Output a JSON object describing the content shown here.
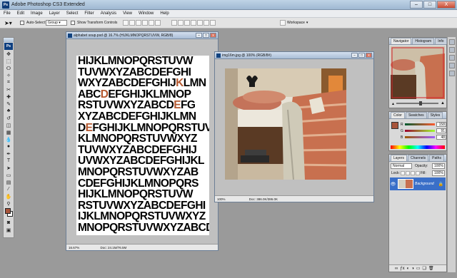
{
  "app": {
    "title": "Adobe Photoshop CS3 Extended",
    "logo": "Ps"
  },
  "window_controls": {
    "minimize": "–",
    "maximize": "□",
    "close": "X"
  },
  "menu": [
    "File",
    "Edit",
    "Image",
    "Layer",
    "Select",
    "Filter",
    "Analysis",
    "View",
    "Window",
    "Help"
  ],
  "options": {
    "auto_select_label": "Auto-Select:",
    "auto_select_value": "Group",
    "transform_label": "Show Transform Controls",
    "workspace_label": "Workspace"
  },
  "toolbox": {
    "logo": "Ps",
    "foreground_color": "#a8543a",
    "background_color": "#ffffff",
    "tools": [
      "move-tool",
      "marquee-tool",
      "lasso-tool",
      "magic-wand-tool",
      "crop-tool",
      "slice-tool",
      "healing-brush-tool",
      "brush-tool",
      "clone-stamp-tool",
      "history-brush-tool",
      "eraser-tool",
      "gradient-tool",
      "blur-tool",
      "dodge-tool",
      "pen-tool",
      "type-tool",
      "path-selection-tool",
      "shape-tool",
      "notes-tool",
      "eyedropper-tool",
      "hand-tool",
      "zoom-tool"
    ],
    "tool_glyphs": [
      "✥",
      "⬚",
      "ⵔ",
      "✧",
      "⌗",
      "✂",
      "✚",
      "✎",
      "♣",
      "↺",
      "◫",
      "▦",
      "💧",
      "●",
      "✒",
      "T",
      "➤",
      "▭",
      "▤",
      "⁄",
      "✋",
      "⚲"
    ]
  },
  "documents": {
    "alphabet": {
      "title": "alphabet soup.psd @ 16.7% (HIJKLMNOPQRSTUVW, RGB/8)",
      "zoom": "16.67%",
      "doc_size": "Doc: 24.1M/76.5M",
      "highlight_color": "#b4582f",
      "lines": [
        [
          "HIJKLMNOPQRSTUVW"
        ],
        [
          "TUVWXYZABCDEFGHI"
        ],
        [
          "WXYZABCDEFGHIJ",
          "K",
          "LMN"
        ],
        [
          "ABC",
          "D",
          "EFGHIJKLMNOP"
        ],
        [
          "RSTUVWXYZABCD",
          "E",
          "FG"
        ],
        [
          "XYZABCDEFGHIJKLMN"
        ],
        [
          "D",
          "E",
          "FGHIJKLMNOPQRSTUV"
        ],
        [
          "KLMNOPQRSTUVWXYZ"
        ],
        [
          "TUVWXYZABCDEFGHIJ"
        ],
        [
          "UVWXYZABCDEFGHIJKL"
        ],
        [
          "MNOPQRSTUVWXYZAB"
        ],
        [
          "CDEFGHIJKLMNOPQRS"
        ],
        [
          "HIJKLMNOPQRSTUVW"
        ],
        [
          "RSTUVWXYZABCDEFGHI"
        ],
        [
          "IJKLMNOPQRSTUVWXYZ"
        ],
        [
          "MNOPQRSTUVWXYZABCD"
        ]
      ]
    },
    "bedroom": {
      "title": "img16m.jpg @ 100% (RGB/8#)",
      "zoom": "100%",
      "doc_size": "Doc: 386.0K/386.0K"
    }
  },
  "navigator": {
    "tabs": [
      "Navigator",
      "Histogram",
      "Info"
    ]
  },
  "color_panel": {
    "tabs": [
      "Color",
      "Swatches",
      "Styles"
    ],
    "swatch": "#a8543a",
    "rows": [
      {
        "label": "R",
        "value": "158"
      },
      {
        "label": "G",
        "value": "91"
      },
      {
        "label": "B",
        "value": "48"
      }
    ]
  },
  "layers_panel": {
    "tabs": [
      "Layers",
      "Channels",
      "Paths"
    ],
    "blend_mode": "Normal",
    "opacity_label": "Opacity:",
    "opacity_value": "100%",
    "lock_label": "Lock:",
    "fill_label": "Fill:",
    "fill_value": "100%",
    "layer_name": "Background",
    "selected_color": "#3a6fc8"
  }
}
